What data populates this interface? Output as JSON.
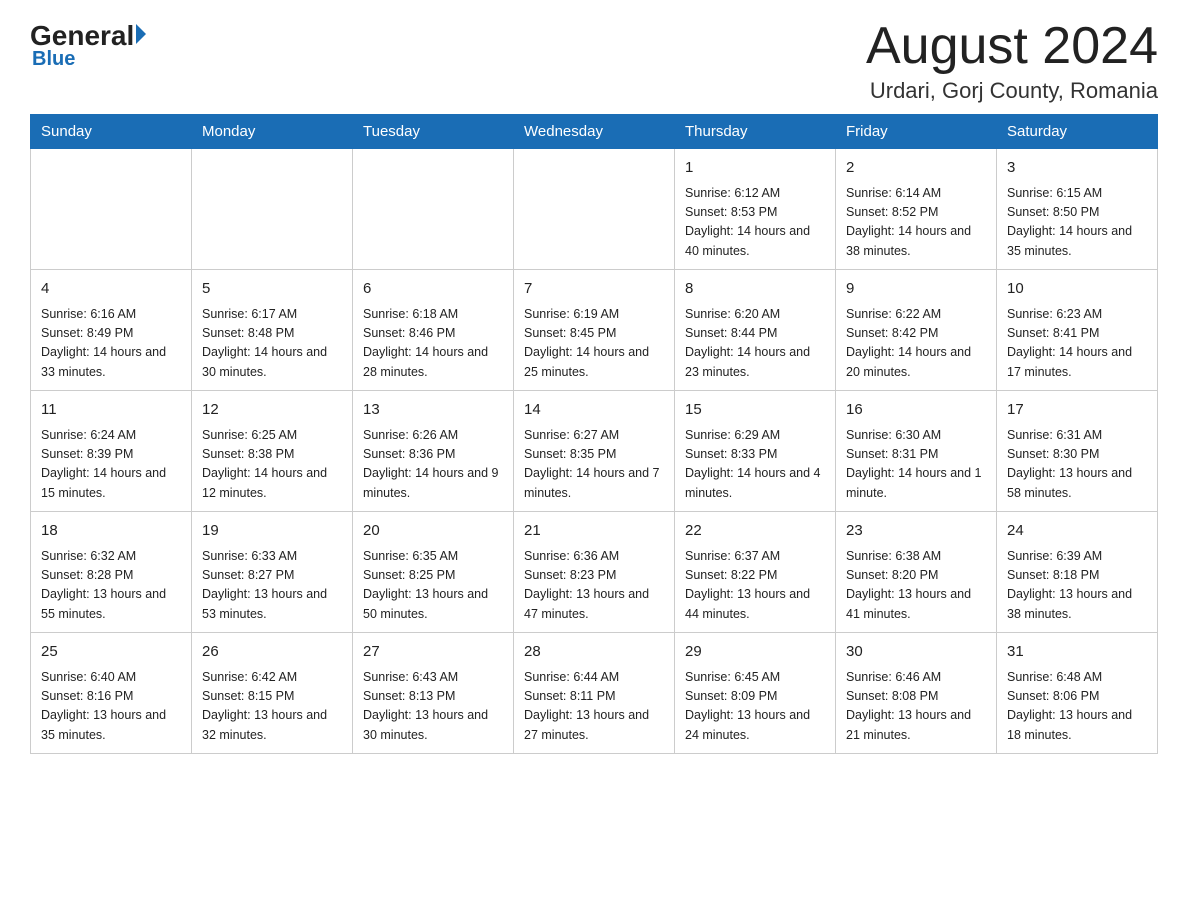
{
  "header": {
    "logo_general": "General",
    "logo_blue": "Blue",
    "month_title": "August 2024",
    "location": "Urdari, Gorj County, Romania"
  },
  "weekdays": [
    "Sunday",
    "Monday",
    "Tuesday",
    "Wednesday",
    "Thursday",
    "Friday",
    "Saturday"
  ],
  "weeks": [
    [
      {
        "day": "",
        "info": ""
      },
      {
        "day": "",
        "info": ""
      },
      {
        "day": "",
        "info": ""
      },
      {
        "day": "",
        "info": ""
      },
      {
        "day": "1",
        "info": "Sunrise: 6:12 AM\nSunset: 8:53 PM\nDaylight: 14 hours and 40 minutes."
      },
      {
        "day": "2",
        "info": "Sunrise: 6:14 AM\nSunset: 8:52 PM\nDaylight: 14 hours and 38 minutes."
      },
      {
        "day": "3",
        "info": "Sunrise: 6:15 AM\nSunset: 8:50 PM\nDaylight: 14 hours and 35 minutes."
      }
    ],
    [
      {
        "day": "4",
        "info": "Sunrise: 6:16 AM\nSunset: 8:49 PM\nDaylight: 14 hours and 33 minutes."
      },
      {
        "day": "5",
        "info": "Sunrise: 6:17 AM\nSunset: 8:48 PM\nDaylight: 14 hours and 30 minutes."
      },
      {
        "day": "6",
        "info": "Sunrise: 6:18 AM\nSunset: 8:46 PM\nDaylight: 14 hours and 28 minutes."
      },
      {
        "day": "7",
        "info": "Sunrise: 6:19 AM\nSunset: 8:45 PM\nDaylight: 14 hours and 25 minutes."
      },
      {
        "day": "8",
        "info": "Sunrise: 6:20 AM\nSunset: 8:44 PM\nDaylight: 14 hours and 23 minutes."
      },
      {
        "day": "9",
        "info": "Sunrise: 6:22 AM\nSunset: 8:42 PM\nDaylight: 14 hours and 20 minutes."
      },
      {
        "day": "10",
        "info": "Sunrise: 6:23 AM\nSunset: 8:41 PM\nDaylight: 14 hours and 17 minutes."
      }
    ],
    [
      {
        "day": "11",
        "info": "Sunrise: 6:24 AM\nSunset: 8:39 PM\nDaylight: 14 hours and 15 minutes."
      },
      {
        "day": "12",
        "info": "Sunrise: 6:25 AM\nSunset: 8:38 PM\nDaylight: 14 hours and 12 minutes."
      },
      {
        "day": "13",
        "info": "Sunrise: 6:26 AM\nSunset: 8:36 PM\nDaylight: 14 hours and 9 minutes."
      },
      {
        "day": "14",
        "info": "Sunrise: 6:27 AM\nSunset: 8:35 PM\nDaylight: 14 hours and 7 minutes."
      },
      {
        "day": "15",
        "info": "Sunrise: 6:29 AM\nSunset: 8:33 PM\nDaylight: 14 hours and 4 minutes."
      },
      {
        "day": "16",
        "info": "Sunrise: 6:30 AM\nSunset: 8:31 PM\nDaylight: 14 hours and 1 minute."
      },
      {
        "day": "17",
        "info": "Sunrise: 6:31 AM\nSunset: 8:30 PM\nDaylight: 13 hours and 58 minutes."
      }
    ],
    [
      {
        "day": "18",
        "info": "Sunrise: 6:32 AM\nSunset: 8:28 PM\nDaylight: 13 hours and 55 minutes."
      },
      {
        "day": "19",
        "info": "Sunrise: 6:33 AM\nSunset: 8:27 PM\nDaylight: 13 hours and 53 minutes."
      },
      {
        "day": "20",
        "info": "Sunrise: 6:35 AM\nSunset: 8:25 PM\nDaylight: 13 hours and 50 minutes."
      },
      {
        "day": "21",
        "info": "Sunrise: 6:36 AM\nSunset: 8:23 PM\nDaylight: 13 hours and 47 minutes."
      },
      {
        "day": "22",
        "info": "Sunrise: 6:37 AM\nSunset: 8:22 PM\nDaylight: 13 hours and 44 minutes."
      },
      {
        "day": "23",
        "info": "Sunrise: 6:38 AM\nSunset: 8:20 PM\nDaylight: 13 hours and 41 minutes."
      },
      {
        "day": "24",
        "info": "Sunrise: 6:39 AM\nSunset: 8:18 PM\nDaylight: 13 hours and 38 minutes."
      }
    ],
    [
      {
        "day": "25",
        "info": "Sunrise: 6:40 AM\nSunset: 8:16 PM\nDaylight: 13 hours and 35 minutes."
      },
      {
        "day": "26",
        "info": "Sunrise: 6:42 AM\nSunset: 8:15 PM\nDaylight: 13 hours and 32 minutes."
      },
      {
        "day": "27",
        "info": "Sunrise: 6:43 AM\nSunset: 8:13 PM\nDaylight: 13 hours and 30 minutes."
      },
      {
        "day": "28",
        "info": "Sunrise: 6:44 AM\nSunset: 8:11 PM\nDaylight: 13 hours and 27 minutes."
      },
      {
        "day": "29",
        "info": "Sunrise: 6:45 AM\nSunset: 8:09 PM\nDaylight: 13 hours and 24 minutes."
      },
      {
        "day": "30",
        "info": "Sunrise: 6:46 AM\nSunset: 8:08 PM\nDaylight: 13 hours and 21 minutes."
      },
      {
        "day": "31",
        "info": "Sunrise: 6:48 AM\nSunset: 8:06 PM\nDaylight: 13 hours and 18 minutes."
      }
    ]
  ]
}
